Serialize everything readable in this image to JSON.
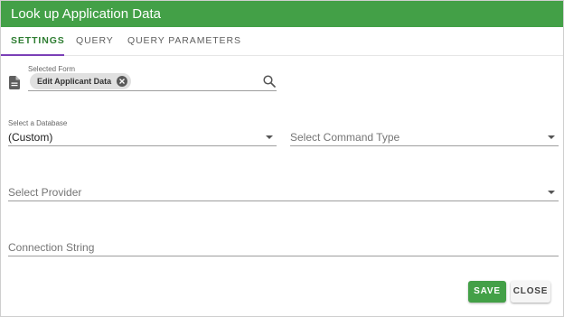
{
  "dialog": {
    "title": "Look up Application Data",
    "accent_color": "#43a047"
  },
  "tabs": [
    {
      "label": "SETTINGS",
      "active": true
    },
    {
      "label": "QUERY",
      "active": false
    },
    {
      "label": "QUERY PARAMETERS",
      "active": false
    }
  ],
  "form_select": {
    "label": "Selected Form",
    "icon": "document-icon",
    "chip_label": "Edit Applicant Data",
    "search_icon": "search-icon"
  },
  "database": {
    "label": "Select a Database",
    "value": "(Custom)"
  },
  "command_type": {
    "placeholder": "Select Command Type"
  },
  "provider": {
    "placeholder": "Select Provider"
  },
  "connection_string": {
    "placeholder": "Connection String"
  },
  "actions": {
    "save_label": "SAVE",
    "close_label": "CLOSE"
  }
}
